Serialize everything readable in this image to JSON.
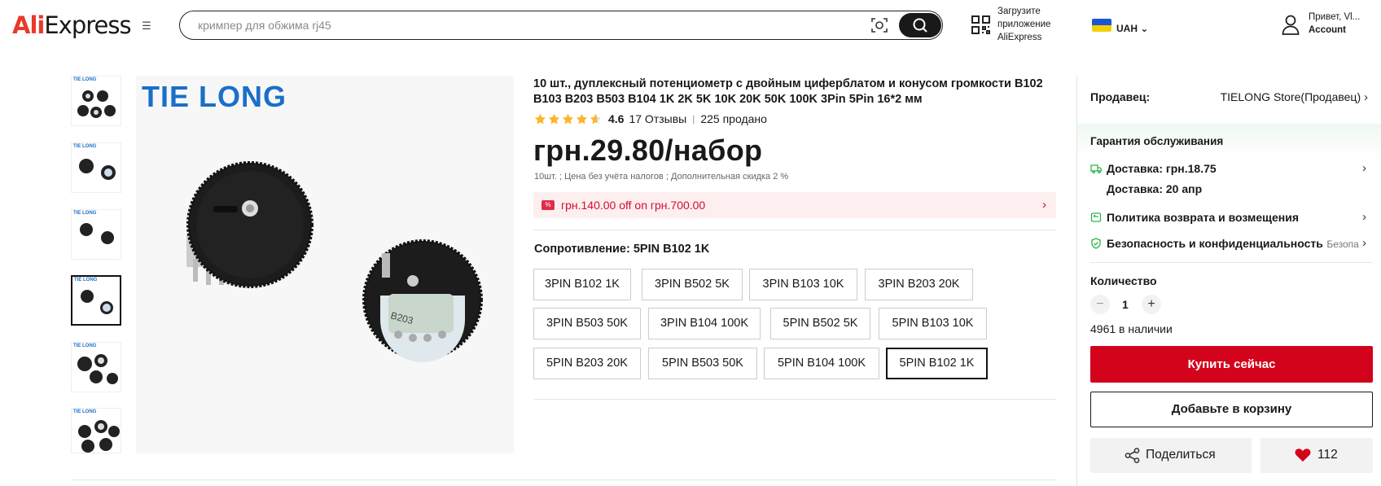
{
  "header": {
    "logo_main": "Ali",
    "logo_rest": "Express",
    "search_placeholder": "кримпер для обжима rj45",
    "app_promo": [
      "Загрузите",
      "приложение",
      "AliExpress"
    ],
    "currency": "UAH",
    "greeting": "Привет, Vl...",
    "account": "Account"
  },
  "gallery": {
    "brand_text": "TIE LONG",
    "selected_index": 3,
    "thumb_count": 6
  },
  "product": {
    "title": "10 шт., дуплексный потенциометр с двойным циферблатом и конусом громкости B102 B103 B203 B503 B104 1K 2K 5K 10K 20K 50K 100K 3Pin 5Pin 16*2 мм",
    "rating": "4.6",
    "rating_value": 4.6,
    "reviews": "17 Отзывы",
    "separator": "|",
    "sold": "225 продано",
    "price": "грн.29.80/набор",
    "price_note": "10шт. ; Цена без учёта налогов ; Дополнительная скидка 2 %",
    "promo": "грн.140.00 off on грн.700.00",
    "promo_icon": "coupon-icon",
    "variant_label": "Сопротивление: 5PIN B102 1K",
    "options": [
      [
        "3PIN B102 1K",
        "3PIN B502 5K",
        "3PIN B103 10K",
        "3PIN B203 20K"
      ],
      [
        "3PIN B503 50K",
        "3PIN B104 100K",
        "5PIN B502 5K",
        "5PIN B103 10K"
      ],
      [
        "5PIN B203 20K",
        "5PIN B503 50K",
        "5PIN B104 100K",
        "5PIN B102 1K"
      ]
    ],
    "selected_option": "5PIN B102 1K"
  },
  "panel": {
    "seller_label": "Продавец:",
    "seller_value": "TIELONG Store(Продавец)",
    "guarantee": "Гарантия обслуживания",
    "delivery_price": "Доставка: грн.18.75",
    "delivery_date": "Доставка: 20 апр",
    "returns": "Политика возврата и возмещения",
    "security": "Безопасность и конфиденциальность",
    "security_sub": "Безопа...",
    "qty_label": "Количество",
    "qty_minus": "−",
    "qty_value": "1",
    "qty_plus": "+",
    "stock": "4961 в наличии",
    "buy_now": "Купить сейчас",
    "add_cart": "Добавьте в корзину",
    "share": "Поделиться",
    "wishlist_count": "112"
  },
  "colors": {
    "accent_red": "#d3031c",
    "promo_red": "#d40c2c",
    "brand_blue": "#1a6fc9",
    "guarantee_green": "#2cb34a"
  }
}
